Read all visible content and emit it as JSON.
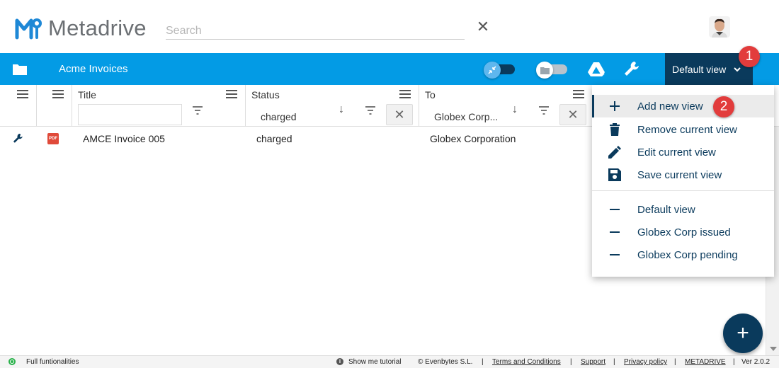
{
  "header": {
    "app_name": "Metadrive",
    "search_placeholder": "Search",
    "clear_search_glyph": "✕",
    "avatar_icon": "user-avatar"
  },
  "toolbar": {
    "folder_icon": "folder-icon",
    "title": "Acme Invoices",
    "view_button_label": "Default view",
    "badge_1": "1"
  },
  "grid": {
    "columns": [
      {
        "title": "",
        "kind": "actions"
      },
      {
        "title": "",
        "kind": "icon"
      },
      {
        "title": "Title",
        "filter_value": ""
      },
      {
        "title": "Status",
        "filter_value": "charged"
      },
      {
        "title": "To",
        "filter_value": "Globex Corp..."
      }
    ],
    "rows": [
      {
        "title": "AMCE Invoice 005",
        "status": "charged",
        "to": "Globex Corporation",
        "file_type": "PDF"
      }
    ]
  },
  "dropdown": {
    "badge_2": "2",
    "actions": [
      {
        "label": "Add new view",
        "icon": "plus-icon"
      },
      {
        "label": "Remove current view",
        "icon": "trash-icon"
      },
      {
        "label": "Edit current view",
        "icon": "pencil-icon"
      },
      {
        "label": "Save current view",
        "icon": "save-icon"
      }
    ],
    "views": [
      {
        "label": "Default view",
        "icon": "dash-icon"
      },
      {
        "label": "Globex Corp issued",
        "icon": "dash-icon"
      },
      {
        "label": "Globex Corp pending",
        "icon": "dash-icon"
      }
    ]
  },
  "fab": {
    "label": "+"
  },
  "footer": {
    "status": "Full funtionalities",
    "tutorial": "Show me tutorial",
    "copyright": "© Evenbytes S.L.",
    "terms": "Terms and Conditions",
    "support": "Support",
    "privacy": "Privacy policy",
    "brand": "METADRIVE",
    "version": "Ver 2.0.2",
    "separator": "|"
  },
  "colors": {
    "primary_blue": "#039be5",
    "navy": "#0a3a5c",
    "badge_red": "#e23c3c",
    "status_green": "#2bb24c"
  }
}
